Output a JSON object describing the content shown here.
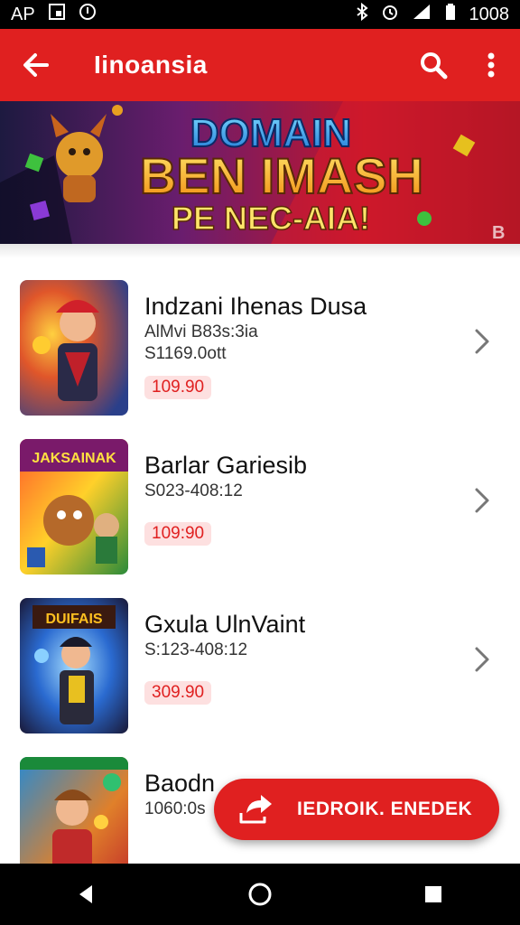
{
  "status_bar": {
    "carrier": "AP",
    "time": "1008"
  },
  "app_bar": {
    "title": "Iinoansia"
  },
  "banner": {
    "line1": "DOMAIN",
    "line2": "BEN IMASH",
    "line3": "PE  NEC-AIA!"
  },
  "items": [
    {
      "name": "Indzani Ihenas Dusa",
      "sub1": "AlMvi B83s:3ia",
      "sub2": "S1169.0ott",
      "price": "109.90"
    },
    {
      "name": "Barlar Gariesib",
      "sub1": "S023-408:12",
      "sub2": "",
      "price": "109:90"
    },
    {
      "name": "Gxula UlnVaint",
      "sub1": "S:123-408:12",
      "sub2": "",
      "price": "309.90"
    },
    {
      "name": "Baodn",
      "sub1": "1060:0s",
      "sub2": "",
      "price": ""
    }
  ],
  "thumb_titles": [
    "",
    "JAKSAINAK",
    "DUIFAIS",
    ""
  ],
  "fab": {
    "label": "IEDROIK. ENEDEK"
  },
  "colors": {
    "primary": "#e02020",
    "price_bg": "#fde0e0"
  },
  "icons": [
    "back-arrow-icon",
    "search-icon",
    "more-vert-icon",
    "chevron-right-icon",
    "share-icon",
    "nav-back-icon",
    "nav-home-icon",
    "nav-recents-icon"
  ]
}
